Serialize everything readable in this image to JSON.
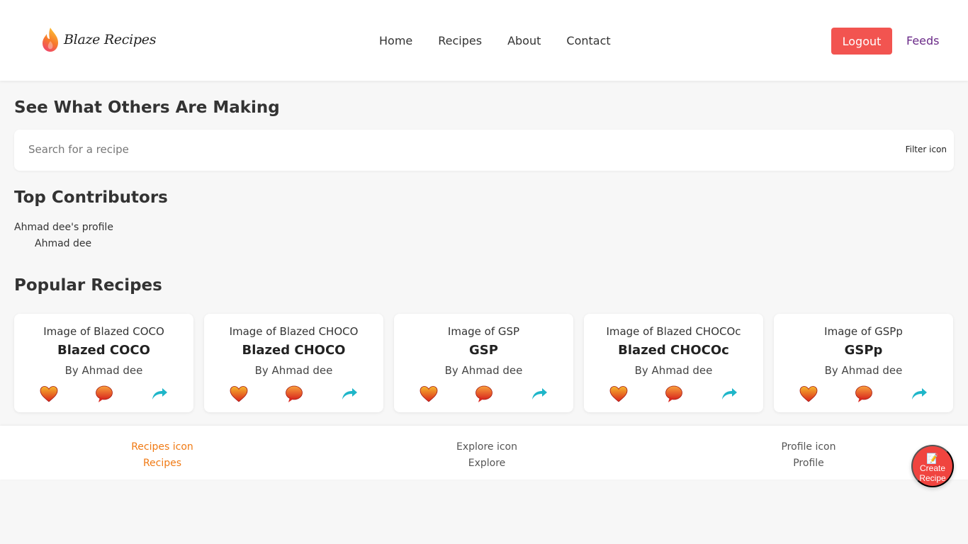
{
  "header": {
    "logo_text": "Blaze Recipes",
    "nav": [
      "Home",
      "Recipes",
      "About",
      "Contact"
    ],
    "logout_label": "Logout",
    "feeds_label": "Feeds"
  },
  "main": {
    "title": "See What Others Are Making",
    "search": {
      "placeholder": "Search for a recipe",
      "filter_icon_alt": "Filter icon"
    },
    "contributors_title": "Top Contributors",
    "contributor": {
      "profile_alt": "Ahmad dee's profile",
      "name": "Ahmad dee"
    },
    "popular_title": "Popular Recipes",
    "recipes": [
      {
        "image_alt": "Image of Blazed COCO",
        "title": "Blazed COCO",
        "author": "By Ahmad dee"
      },
      {
        "image_alt": "Image of Blazed CHOCO",
        "title": "Blazed CHOCO",
        "author": "By Ahmad dee"
      },
      {
        "image_alt": "Image of GSP",
        "title": "GSP",
        "author": "By Ahmad dee"
      },
      {
        "image_alt": "Image of Blazed CHOCOc",
        "title": "Blazed CHOCOc",
        "author": "By Ahmad dee"
      },
      {
        "image_alt": "Image of GSPp",
        "title": "GSPp",
        "author": "By Ahmad dee"
      }
    ]
  },
  "bottom_nav": [
    {
      "icon_alt": "Recipes icon",
      "label": "Recipes",
      "active": true
    },
    {
      "icon_alt": "Explore icon",
      "label": "Explore",
      "active": false
    },
    {
      "icon_alt": "Profile icon",
      "label": "Profile",
      "active": false
    }
  ],
  "fab": {
    "label_line1": "Create",
    "label_line2": "Recipe",
    "icon": "notepad-icon"
  },
  "colors": {
    "logout": "#f25450",
    "feeds": "#6a2a88",
    "active_nav": "#f07a14",
    "fab": "#f0443f"
  },
  "icons": {
    "like": "heart-icon",
    "comment": "comment-bubble-icon",
    "share": "share-arrow-icon"
  }
}
